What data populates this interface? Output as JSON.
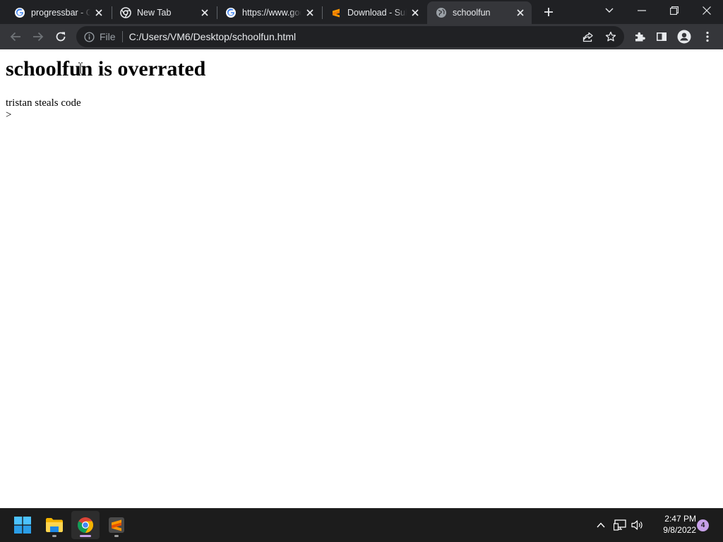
{
  "browser": {
    "tabs": [
      {
        "title": "progressbar - Google Search",
        "favicon": "google-icon",
        "active": false
      },
      {
        "title": "New Tab",
        "favicon": "chrome-icon",
        "active": false
      },
      {
        "title": "https://www.google.com",
        "favicon": "google-icon",
        "active": false
      },
      {
        "title": "Download - Sublime Text",
        "favicon": "sublime-icon",
        "active": false
      },
      {
        "title": "schoolfun",
        "favicon": "globe-icon",
        "active": true
      }
    ],
    "address_bar": {
      "scheme_label": "File",
      "url": "C:/Users/VM6/Desktop/schoolfun.html"
    }
  },
  "page": {
    "heading": "schoolfun is overrated",
    "line1": "tristan steals code",
    "line2": ">"
  },
  "taskbar": {
    "apps": [
      "windows-start",
      "file-explorer",
      "google-chrome",
      "sublime-text"
    ],
    "clock_time": "2:47 PM",
    "clock_date": "9/8/2022",
    "notification_count": "4"
  },
  "colors": {
    "tabstrip": "#202124",
    "toolbar": "#35363a",
    "omnibox": "#202124",
    "taskbar": "#1c1c1c",
    "notification_badge": "#c7a0e8"
  }
}
